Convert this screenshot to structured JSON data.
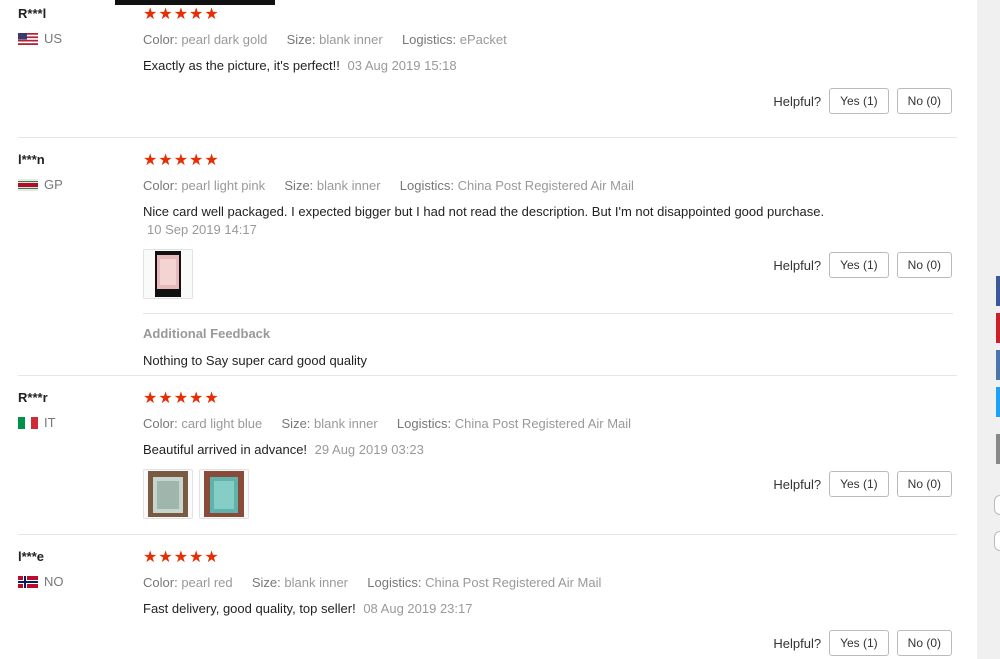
{
  "reviews": [
    {
      "user": "R***l",
      "country_code": "US",
      "stars": "★★★★★",
      "color_label": "Color:",
      "color": "pearl dark gold",
      "size_label": "Size:",
      "size": "blank inner",
      "logistics_label": "Logistics:",
      "logistics": "ePacket",
      "text": "Exactly as the picture, it's perfect!!",
      "date": "03 Aug 2019 15:18",
      "helpful_label": "Helpful?",
      "yes": "Yes (1)",
      "no": "No (0)"
    },
    {
      "user": "l***n",
      "country_code": "GP",
      "stars": "★★★★★",
      "color_label": "Color:",
      "color": "pearl light pink",
      "size_label": "Size:",
      "size": "blank inner",
      "logistics_label": "Logistics:",
      "logistics": "China Post Registered Air Mail",
      "text": "Nice card well packaged. I expected bigger but I had not read the description. But I'm not disappointed good purchase.",
      "date": "10 Sep 2019 14:17",
      "helpful_label": "Helpful?",
      "yes": "Yes (1)",
      "no": "No (0)",
      "additional_title": "Additional Feedback",
      "additional_text": "Nothing to Say super card good quality"
    },
    {
      "user": "R***r",
      "country_code": "IT",
      "stars": "★★★★★",
      "color_label": "Color:",
      "color": "card light blue",
      "size_label": "Size:",
      "size": "blank inner",
      "logistics_label": "Logistics:",
      "logistics": "China Post Registered Air Mail",
      "text": "Beautiful arrived in advance!",
      "date": "29 Aug 2019 03:23",
      "helpful_label": "Helpful?",
      "yes": "Yes (1)",
      "no": "No (0)"
    },
    {
      "user": "l***e",
      "country_code": "NO",
      "stars": "★★★★★",
      "color_label": "Color:",
      "color": "pearl red",
      "size_label": "Size:",
      "size": "blank inner",
      "logistics_label": "Logistics:",
      "logistics": "China Post Registered Air Mail",
      "text": "Fast delivery, good quality, top seller!",
      "date": "08 Aug 2019 23:17",
      "helpful_label": "Helpful?",
      "yes": "Yes (1)",
      "no": "No (0)"
    }
  ],
  "colors": {
    "star": "#e62e04",
    "share_facebook": "#3b5998",
    "share_pinterest": "#cb2027",
    "share_vk": "#4a76a8",
    "share_twitter": "#1da1f2"
  }
}
